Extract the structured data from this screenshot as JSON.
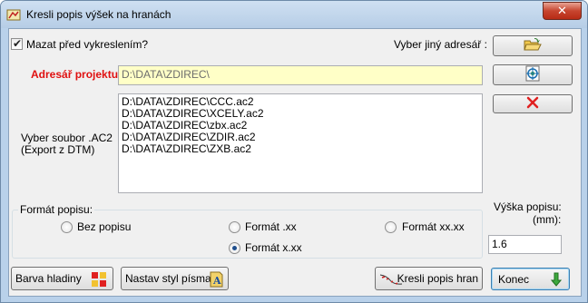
{
  "window": {
    "title": "Kresli popis výšek na hranách",
    "close_label": "✕"
  },
  "top": {
    "delete_checkbox_label": "Mazat před vykreslením?",
    "delete_checked": true,
    "choose_other_label": "Vyber jiný adresář :"
  },
  "project": {
    "label": "Adresář projektu:",
    "label_color": "#e01010",
    "path": "D:\\DATA\\ZDIREC\\"
  },
  "files": {
    "label_line1": "Vyber soubor .AC2",
    "label_line2": "(Export z DTM)",
    "items": [
      "D:\\DATA\\ZDIREC\\CCC.ac2",
      "D:\\DATA\\ZDIREC\\XCELY.ac2",
      "D:\\DATA\\ZDIREC\\zbx.ac2",
      "D:\\DATA\\ZDIREC\\ZDIR.ac2",
      "D:\\DATA\\ZDIREC\\ZXB.ac2"
    ]
  },
  "format": {
    "group_label": "Formát popisu:",
    "options": [
      "Bez popisu",
      "Formát .xx",
      "Formát xx.xx",
      "Formát x.xx"
    ],
    "selected": "Formát x.xx"
  },
  "height": {
    "label_line1": "Výška popisu:",
    "label_line2": "(mm):",
    "value": "1.6"
  },
  "buttons": {
    "level_color": "Barva hladiny",
    "font_style": "Nastav styl písma",
    "draw": "Kresli popis hran",
    "end": "Konec"
  }
}
